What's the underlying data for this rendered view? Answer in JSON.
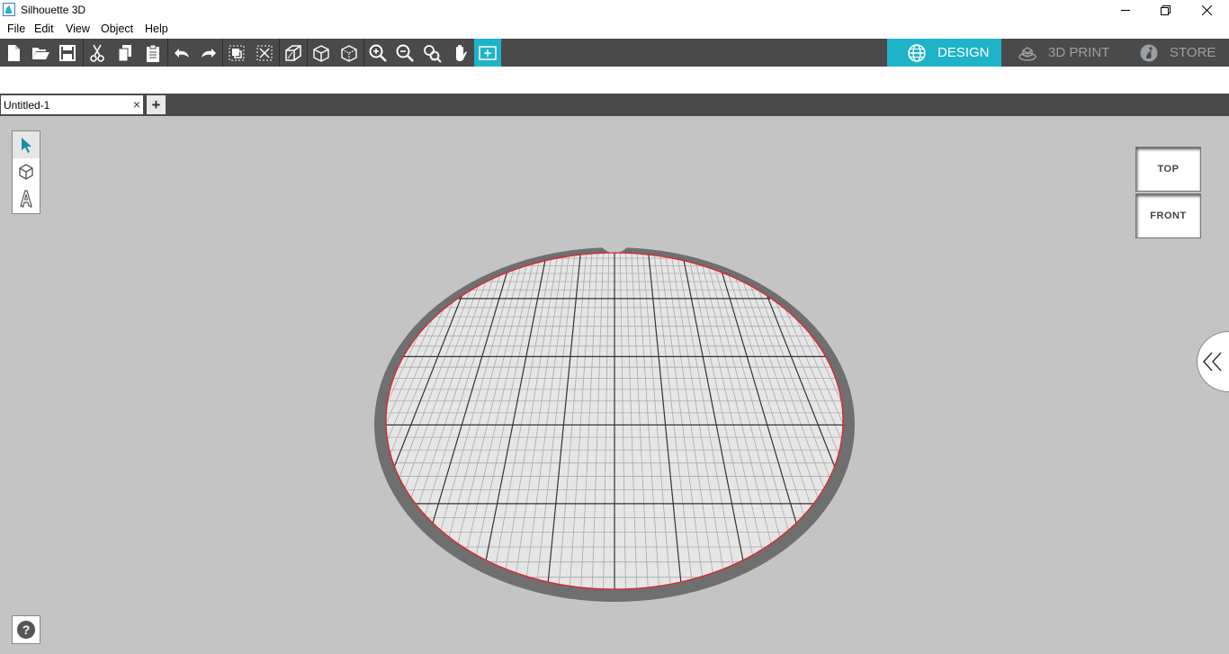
{
  "window": {
    "title": "Silhouette 3D"
  },
  "menu": [
    "File",
    "Edit",
    "View",
    "Object",
    "Help"
  ],
  "toolbar": {
    "buttons": [
      "new-file",
      "open-folder",
      "save",
      "cut",
      "copy",
      "paste",
      "undo",
      "redo",
      "group",
      "ungroup",
      "extrude",
      "view-box",
      "view-box-alt",
      "zoom-in",
      "zoom-out",
      "zoom-fit",
      "pan-hand",
      "fit-to-page"
    ],
    "active": "fit-to-page",
    "accent": "#1fb3c9"
  },
  "modes": [
    {
      "label": "DESIGN",
      "icon": "globe-icon",
      "active": true
    },
    {
      "label": "3D PRINT",
      "icon": "3d-print-icon",
      "active": false
    },
    {
      "label": "STORE",
      "icon": "store-icon",
      "active": false
    }
  ],
  "tabs": {
    "doc": "Untitled-1",
    "close": "×",
    "add": "+"
  },
  "viewcube": {
    "top": "TOP",
    "front": "FRONT"
  },
  "help": "?"
}
